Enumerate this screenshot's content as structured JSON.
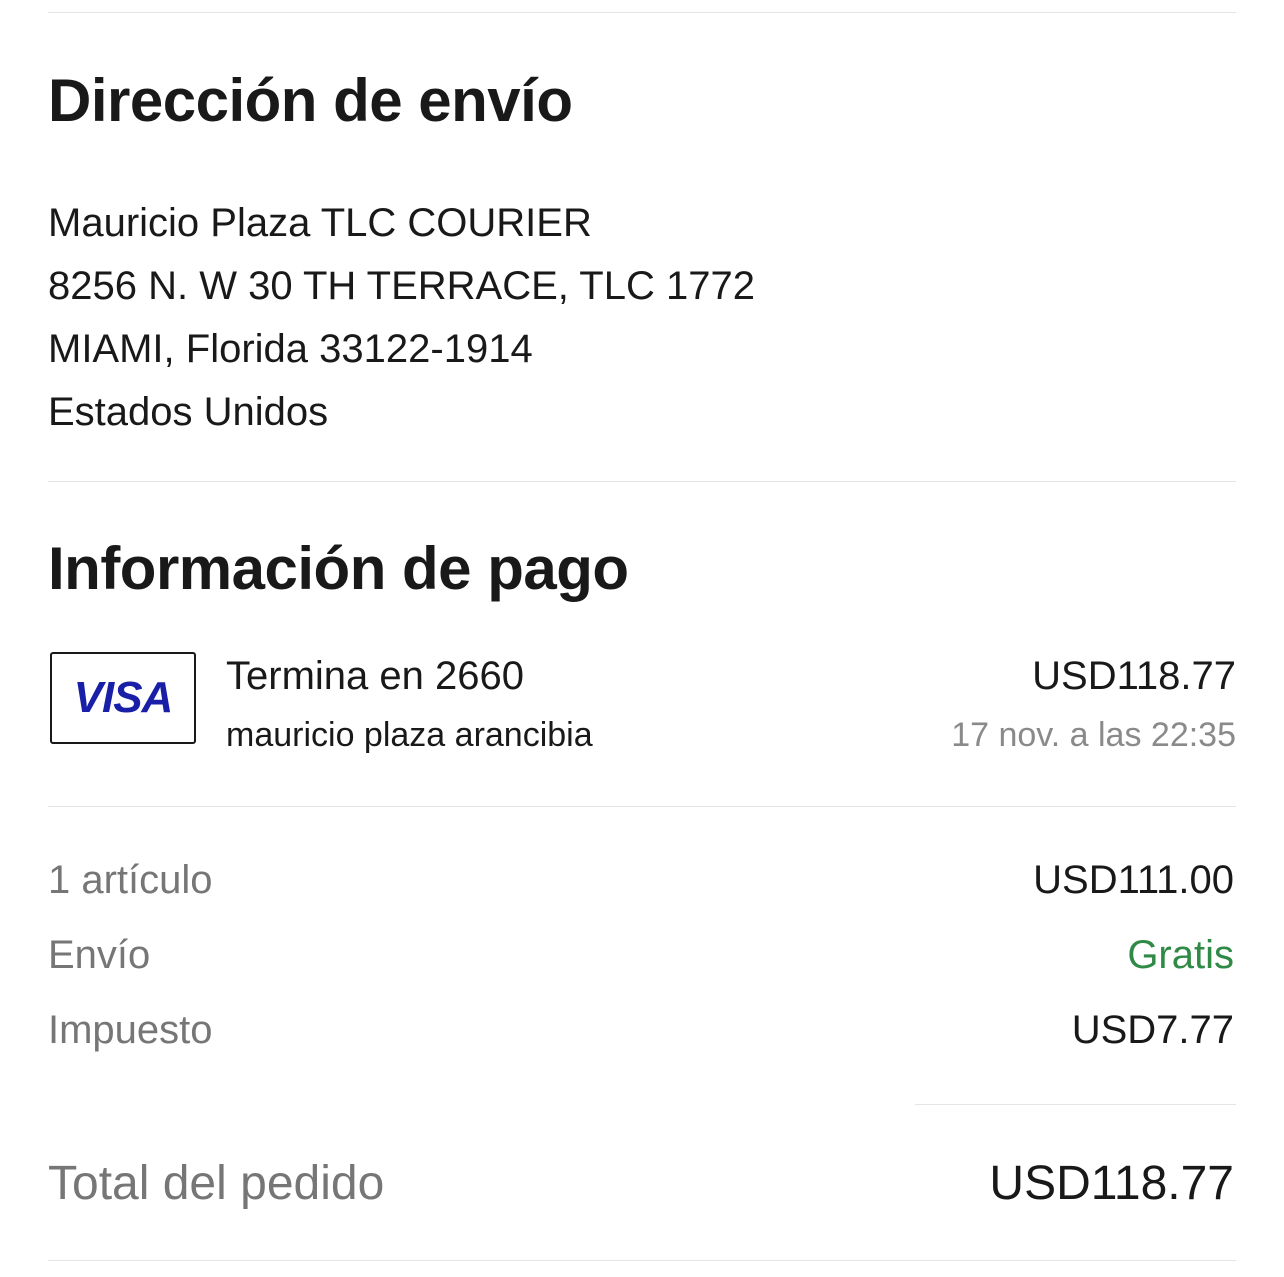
{
  "shipping": {
    "heading": "Dirección de envío",
    "address_lines": [
      "Mauricio Plaza TLC COURIER",
      "8256 N. W 30 TH TERRACE, TLC 1772",
      "MIAMI, Florida 33122-1914",
      "Estados Unidos"
    ]
  },
  "payment": {
    "heading": "Información de pago",
    "card_brand": "VISA",
    "card_brand_color": "#1a1fa8",
    "card_icon": "visa-card-icon",
    "method_title": "Termina en 2660",
    "cardholder": "mauricio plaza arancibia",
    "amount": "USD118.77",
    "date": "17 nov. a las 22:35"
  },
  "summary": {
    "rows": [
      {
        "label": "1 artículo",
        "value": "USD111.00"
      },
      {
        "label": "Envío",
        "value": "Gratis",
        "value_color": "#2f8a45"
      },
      {
        "label": "Impuesto",
        "value": "USD7.77"
      }
    ],
    "total_label": "Total del pedido",
    "total_value": "USD118.77"
  }
}
